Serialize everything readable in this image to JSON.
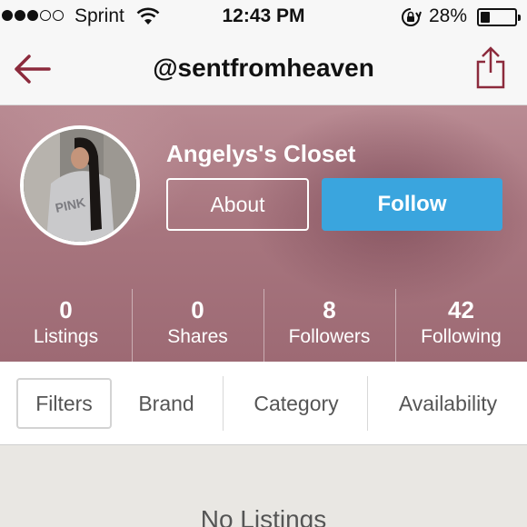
{
  "status_bar": {
    "carrier": "Sprint",
    "time": "12:43 PM",
    "battery": "28%",
    "battery_level": 0.28
  },
  "nav": {
    "title": "@sentfromheaven",
    "back_icon": "back-arrow-icon",
    "share_icon": "share-icon"
  },
  "profile": {
    "shop_name": "Angelys's Closet",
    "about_label": "About",
    "follow_label": "Follow"
  },
  "stats": [
    {
      "value": "0",
      "label": "Listings"
    },
    {
      "value": "0",
      "label": "Shares"
    },
    {
      "value": "8",
      "label": "Followers"
    },
    {
      "value": "42",
      "label": "Following"
    }
  ],
  "filters": [
    "Filters",
    "Brand",
    "Category",
    "Availability"
  ],
  "empty_message": "No Listings",
  "colors": {
    "accent_blue": "#3aa5de",
    "brand_maroon": "#8c2a3c",
    "header_mauve": "#a8767f"
  }
}
